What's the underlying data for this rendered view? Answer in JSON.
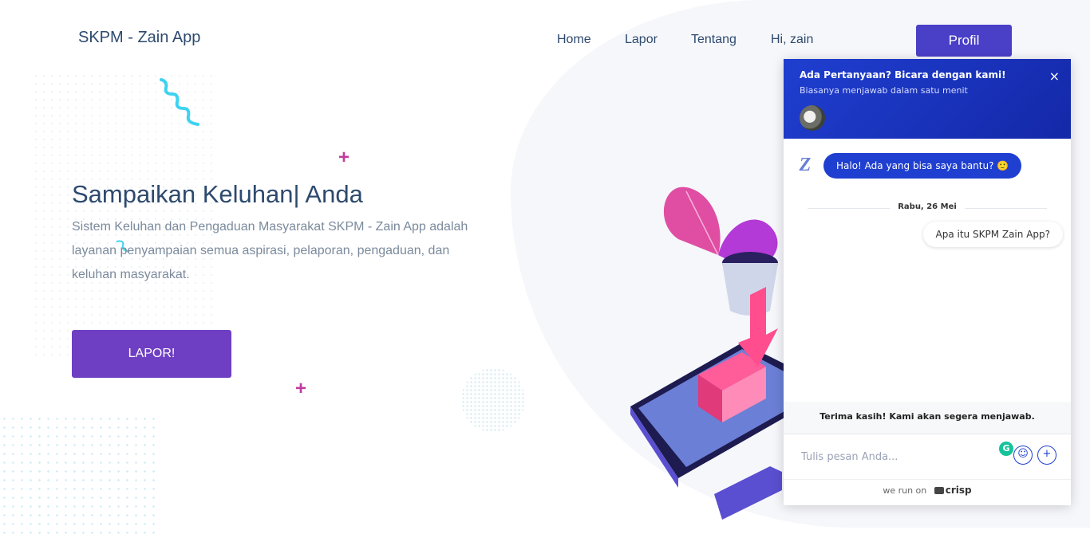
{
  "brand": "SKPM - Zain App",
  "nav": {
    "items": [
      "Home",
      "Lapor",
      "Tentang",
      "Hi, zain"
    ],
    "profil_label": "Profil"
  },
  "hero": {
    "title": "Sampaikan Keluhan| Anda",
    "description": "Sistem Keluhan dan Pengaduan Masyarakat SKPM - Zain App adalah layanan penyampaian semua aspirasi, pelaporan, pengaduan, dan keluhan masyarakat.",
    "button_label": "LAPOR!"
  },
  "chat": {
    "title": "Ada Pertanyaan? Bicara dengan kami!",
    "subtitle": "Biasanya menjawab dalam satu menit",
    "close_icon": "×",
    "bot_message": "Halo! Ada yang bisa saya bantu? 🙂",
    "date_separator": "Rabu, 26 Mei",
    "user_message": "Apa itu SKPM Zain App?",
    "thanks_message": "Terima kasih! Kami akan segera menjawab.",
    "input_placeholder": "Tulis pesan Anda...",
    "powered_prefix": "we run on",
    "powered_brand": "crisp"
  },
  "colors": {
    "primary": "#4a3fc7",
    "lapor_button": "#6f3fc3",
    "chat_header": "#1f3fd0",
    "text": "#2d4a6e",
    "muted_text": "#7b8a9c",
    "accent_pink": "#c13c9c"
  }
}
